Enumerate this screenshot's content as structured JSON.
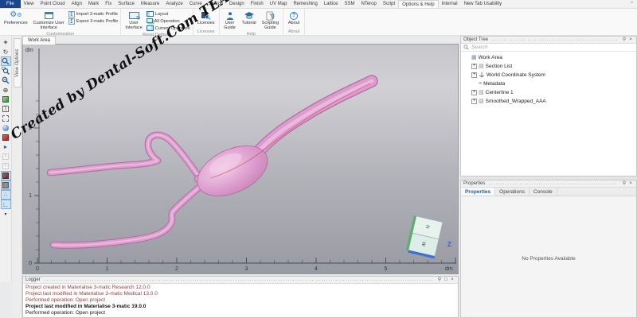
{
  "watermark": {
    "text": "Created by Dental-Soft.Com TEAM"
  },
  "tab_bar": {
    "tabs": [
      {
        "label": "File",
        "variant": "file"
      },
      {
        "label": "View"
      },
      {
        "label": "Point Cloud"
      },
      {
        "label": "Align"
      },
      {
        "label": "Mark"
      },
      {
        "label": "Fix"
      },
      {
        "label": "Surface"
      },
      {
        "label": "Measure"
      },
      {
        "label": "Analyze"
      },
      {
        "label": "Curve"
      },
      {
        "label": "Sketch"
      },
      {
        "label": "Design"
      },
      {
        "label": "Finish"
      },
      {
        "label": "UV Map"
      },
      {
        "label": "Remeshing"
      },
      {
        "label": "Lattice"
      },
      {
        "label": "SSM"
      },
      {
        "label": "NTerop"
      },
      {
        "label": "Script"
      },
      {
        "label": "Options & Help",
        "variant": "active"
      },
      {
        "label": "Internal"
      },
      {
        "label": "New Tab Usability"
      }
    ],
    "collapse_glyph": "^"
  },
  "ribbon": {
    "groups": [
      {
        "label": "Customization",
        "items": [
          {
            "kind": "large",
            "label": "Preferences",
            "icon": "gears-icon"
          },
          {
            "kind": "large",
            "label": "Customize User\nInterface",
            "icon": "window-edit-icon"
          },
          {
            "kind": "smallcol",
            "buttons": [
              {
                "label": "Import 3-matic Profile",
                "icon": "import-icon"
              },
              {
                "label": "Export 3-matic Profile",
                "icon": "export-icon"
              }
            ]
          }
        ]
      },
      {
        "label": "Reset Defaults",
        "items": [
          {
            "kind": "large",
            "label": "User\nInterface",
            "icon": "monitor-reset-icon"
          },
          {
            "kind": "smallcol",
            "buttons": [
              {
                "label": "Layout",
                "icon": "layout-icon"
              },
              {
                "label": "All Operation",
                "icon": "all-operation-icon"
              },
              {
                "label": "Current Operation",
                "icon": "current-operation-icon"
              }
            ]
          }
        ]
      },
      {
        "label": "Licenses",
        "items": [
          {
            "kind": "large",
            "label": "Licenses",
            "icon": "key-icon"
          }
        ]
      },
      {
        "label": "Help",
        "items": [
          {
            "kind": "large",
            "label": "User\nGuide",
            "icon": "user-guide-icon"
          },
          {
            "kind": "large",
            "label": "Tutorial",
            "icon": "tutorial-icon"
          },
          {
            "kind": "large",
            "label": "Scripting\nGuide",
            "icon": "scripting-icon"
          }
        ]
      },
      {
        "label": "About",
        "items": [
          {
            "kind": "large",
            "label": "About",
            "icon": "question-icon"
          }
        ]
      }
    ]
  },
  "left_toolbar": {
    "items": [
      {
        "name": "pan-icon"
      },
      {
        "name": "rotate-icon"
      },
      {
        "name": "zoom-icon",
        "selected": true
      },
      {
        "name": "zoom-window-icon"
      },
      {
        "name": "zoom-out-icon"
      },
      {
        "name": "fit-view-icon"
      },
      {
        "name": "shaded-view-icon"
      },
      {
        "name": "wireframe-view-icon"
      },
      {
        "name": "transparent-view-icon"
      },
      {
        "name": "smooth-shade-icon"
      },
      {
        "name": "backface-view-icon"
      },
      {
        "name": "pick-entity-icon"
      },
      {
        "name": "disabled-tool-icon"
      },
      {
        "name": "disabled-tool-2-icon"
      },
      {
        "name": "solid-view-icon",
        "selected": true
      },
      {
        "name": "textured-view-icon",
        "selected": true
      },
      {
        "name": "point-view-icon",
        "selected": true
      },
      {
        "name": "corner-axis-icon",
        "selected": true
      },
      {
        "name": "more-tools-arrow"
      }
    ]
  },
  "left_strip": {
    "label": "View Options"
  },
  "work_area": {
    "tab_label": "Work Area",
    "v_unit": "dm",
    "h_unit": "dm",
    "h_ticks": [
      "0",
      "1",
      "2",
      "3",
      "4",
      "5"
    ],
    "v_ticks": [
      "2",
      "1",
      "0"
    ],
    "z_axis_label": "Z"
  },
  "object_tree": {
    "title": "Object Tree",
    "search_placeholder": "Search",
    "items": [
      {
        "label": "Work Area",
        "icon": "workarea-icon",
        "expander": false,
        "indent": 0
      },
      {
        "label": "Section List",
        "icon": "sectionlist-icon",
        "expander": true,
        "indent": 1
      },
      {
        "label": "World Coordinate System",
        "icon": "coords-icon",
        "expander": true,
        "indent": 1
      },
      {
        "label": "Metadata",
        "icon": "metadata-icon",
        "expander": false,
        "indent": 1
      },
      {
        "label": "Centerline 1",
        "icon": "mesh-icon",
        "expander": true,
        "indent": 1
      },
      {
        "label": "Smoothed_Wrapped_AAA",
        "icon": "mesh-icon",
        "expander": true,
        "indent": 1
      }
    ]
  },
  "properties": {
    "title": "Properties",
    "tabs": [
      {
        "label": "Properties",
        "active": true
      },
      {
        "label": "Operations"
      },
      {
        "label": "Console"
      }
    ],
    "empty_message": "No Properties Available"
  },
  "logger": {
    "title": "Logger",
    "lines": [
      {
        "text": "Project created in Materialise 3-matic Research 12.0.0",
        "tone": "old"
      },
      {
        "text": "Project last modified in Materialise 3-matic Medical 13.0.0",
        "tone": "old"
      },
      {
        "text": "Performed operation: Open project",
        "tone": "old"
      },
      {
        "text": "Project last modified in Materialise 3-matic 19.0.0",
        "tone": "bold"
      },
      {
        "text": "Performed operation: Open project",
        "tone": "normal"
      }
    ]
  },
  "colors": {
    "brand_blue": "#19478a",
    "model_pink": "#dc9cce",
    "model_edge": "#b26b9f",
    "selection_blue": "#cfe4f7",
    "log_old": "#8e4343"
  }
}
